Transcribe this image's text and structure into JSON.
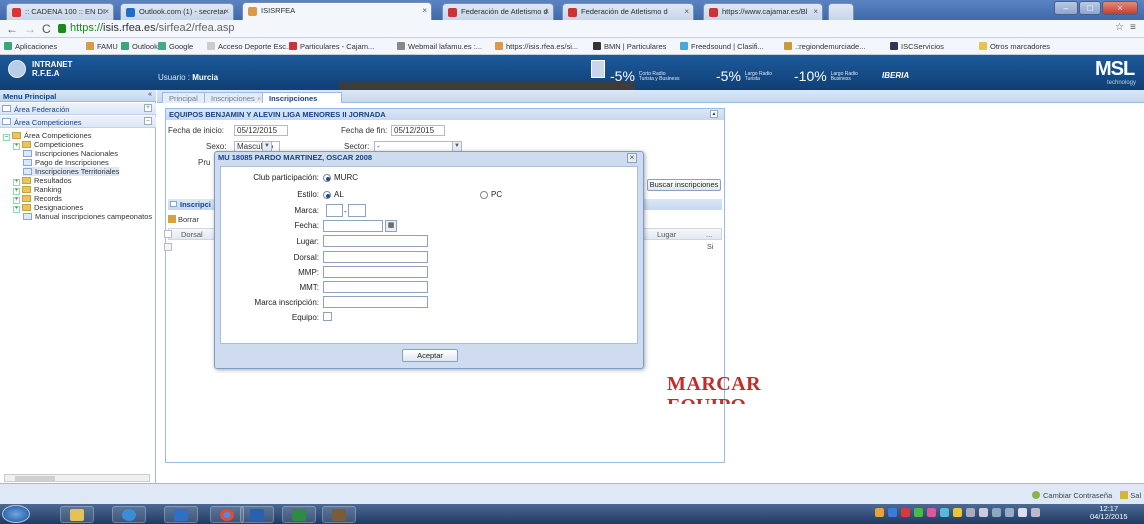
{
  "browser": {
    "tabs": [
      {
        "label": ":: CADENA 100 :: EN DI",
        "fav": "#d33"
      },
      {
        "label": "Outlook.com (1) - secretar",
        "fav": "#1f6fc4"
      },
      {
        "label": "ISISRFEA",
        "fav": "#d94",
        "active": true
      },
      {
        "label": "Federación de Atletismo d",
        "fav": "#c33"
      },
      {
        "label": "Federación de Atletismo d",
        "fav": "#c33"
      },
      {
        "label": "https://www.cajamar.es/Bl",
        "fav": "#c33"
      }
    ],
    "window_controls": [
      "–",
      "□",
      "×"
    ],
    "url": {
      "scheme": "https://",
      "host": "isis.rfea.es",
      "path": "/sirfea2/rfea.asp"
    },
    "bookmarks": [
      {
        "label": "Aplicaciones",
        "color": "#3a7"
      },
      {
        "label": "FAMU",
        "color": "#d94"
      },
      {
        "label": "Outlook",
        "color": "#3a7"
      },
      {
        "label": "Google",
        "color": "#4a8"
      },
      {
        "label": "Acceso Deporte Esc...",
        "color": "#ccc"
      },
      {
        "label": "Particulares - Cajam...",
        "color": "#c33"
      },
      {
        "label": "Webmail lafamu.es :...",
        "color": "#888"
      },
      {
        "label": "https://isis.rfea.es/si...",
        "color": "#d94"
      },
      {
        "label": "BMN | Particulares",
        "color": "#333"
      },
      {
        "label": "Freedsound | Clasifi...",
        "color": "#4ad"
      },
      {
        "label": ".:regiondemurciade...",
        "color": "#c93"
      },
      {
        "label": "ISCServicios",
        "color": "#335"
      },
      {
        "label": "Otros marcadores",
        "color": "#e8c34a"
      }
    ]
  },
  "header": {
    "brand_line1": "INTRANET",
    "brand_line2": "R.F.E.A",
    "usuario_label": "Usuario :",
    "usuario_value": "Murcia",
    "ads": [
      {
        "big": "-5%",
        "small1": "Corto Radio",
        "small2": "Turista y Business"
      },
      {
        "big": "-5%",
        "small1": "Largo Radio",
        "small2": "Turista"
      },
      {
        "big": "-10%",
        "small1": "Largo Radio",
        "small2": "Business"
      }
    ],
    "iberia": "IBERIA",
    "msl": "MSL",
    "msl_sub": "technology"
  },
  "sidebar": {
    "title": "Menu Principal",
    "sections": [
      "Área Federación",
      "Área Competiciones"
    ],
    "tree": [
      {
        "label": "Área Competiciones",
        "indent": 0,
        "kind": "folder-open"
      },
      {
        "label": "Competiciones",
        "indent": 1,
        "kind": "folder"
      },
      {
        "label": "Inscripciones Nacionales",
        "indent": 2,
        "kind": "leaf"
      },
      {
        "label": "Pago de Inscripciones",
        "indent": 2,
        "kind": "leaf"
      },
      {
        "label": "Inscripciones Territoriales",
        "indent": 2,
        "kind": "leaf",
        "selected": true
      },
      {
        "label": "Resultados",
        "indent": 1,
        "kind": "folder"
      },
      {
        "label": "Ranking",
        "indent": 1,
        "kind": "folder"
      },
      {
        "label": "Records",
        "indent": 1,
        "kind": "folder"
      },
      {
        "label": "Designaciones",
        "indent": 1,
        "kind": "folder"
      },
      {
        "label": "Manual inscripciones campeonatos",
        "indent": 2,
        "kind": "leaf"
      }
    ]
  },
  "main": {
    "tabs": [
      {
        "label": "Principal",
        "active": false
      },
      {
        "label": "Inscripciones",
        "active": false
      },
      {
        "label": "Inscripciones",
        "active": true
      }
    ],
    "panel_title": "EQUIPOS BENJAMIN Y ALEVIN LIGA MENORES II JORNADA",
    "fecha_inicio_label": "Fecha de inicio:",
    "fecha_inicio": "05/12/2015",
    "fecha_fin_label": "Fecha de fin:",
    "fecha_fin": "05/12/2015",
    "sexo_label": "Sexo:",
    "sexo": "Masculino",
    "sector_label": "Sector:",
    "sector": "-",
    "prueba_label": "Pru",
    "buscar": "Buscar inscripciones",
    "inscripciones_title": "Inscripci",
    "borrar": "Borrar",
    "col_dorsal": "Dorsal",
    "col_lugar": "Lugar",
    "col_more": "...",
    "row_cell": "Si"
  },
  "annotation": {
    "line1": "MARCAR",
    "line2": "EQUIPO"
  },
  "modal": {
    "title": "MU 18085 PARDO MARTINEZ, OSCAR 2008",
    "club_label": "Club participación:",
    "club_value": "MURC",
    "estilo_label": "Estilo:",
    "estilo_al": "AL",
    "estilo_pc": "PC",
    "marca_label": "Marca:",
    "marca_sep": "-",
    "fecha_label": "Fecha:",
    "lugar_label": "Lugar:",
    "dorsal_label": "Dorsal:",
    "mmp_label": "MMP:",
    "mmt_label": "MMT:",
    "marca_insc_label": "Marca inscripción:",
    "equipo_label": "Equipo:",
    "aceptar": "Aceptar"
  },
  "footer": {
    "cambiar": "Cambiar Contraseña",
    "salir": "Sal"
  },
  "taskbar": {
    "time": "12:17",
    "date": "04/12/2015"
  }
}
